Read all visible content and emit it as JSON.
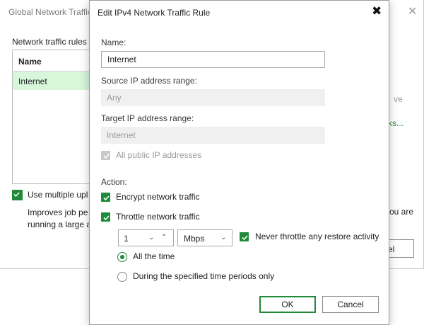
{
  "background_window": {
    "title": "Global Network Traffic",
    "close_glyph": "✕",
    "rules_label": "Network traffic rules",
    "table": {
      "columns": [
        "Name"
      ],
      "rows": [
        "Internet"
      ]
    },
    "multi_upload_label": "Use multiple upl",
    "improves_text_line1": "Improves job pe",
    "improves_text_line2": "running a large a",
    "right_text1": "ve",
    "right_link": "rks...",
    "right_text2": "you are",
    "cancel_partial": "el"
  },
  "dialog": {
    "title": "Edit IPv4 Network Traffic Rule",
    "close_glyph": "✖",
    "name_label": "Name:",
    "name_value": "Internet",
    "source_label": "Source IP address range:",
    "source_value": "Any",
    "target_label": "Target IP address range:",
    "target_value": "Internet",
    "public_ip_label": "All public IP addresses",
    "action_label": "Action:",
    "encrypt_label": "Encrypt network traffic",
    "throttle_label": "Throttle network traffic",
    "rate_value": "1",
    "spin_down_glyph": "⌄",
    "spin_up_glyph": "⌃",
    "unit_value": "Mbps",
    "unit_caret_glyph": "⌄",
    "restore_label": "Never throttle any restore activity",
    "radio_all_label": "All the time",
    "radio_periods_label": "During the specified time periods only",
    "ok_label": "OK",
    "cancel_label": "Cancel"
  },
  "state": {
    "public_ip_checked": true,
    "public_ip_disabled": true,
    "encrypt_checked": true,
    "throttle_checked": true,
    "restore_checked": true,
    "multi_upload_checked": true,
    "selected_schedule": "All the time"
  },
  "colors": {
    "accent_green": "#1f8a3a",
    "selected_row": "#d7f6da",
    "disabled_field": "#f0f0f0"
  },
  "icons": {
    "close": "close-icon",
    "checkbox": "checkmark-icon",
    "spin_down": "chevron-down-icon",
    "spin_up": "chevron-up-icon",
    "dropdown": "chevron-down-icon"
  }
}
